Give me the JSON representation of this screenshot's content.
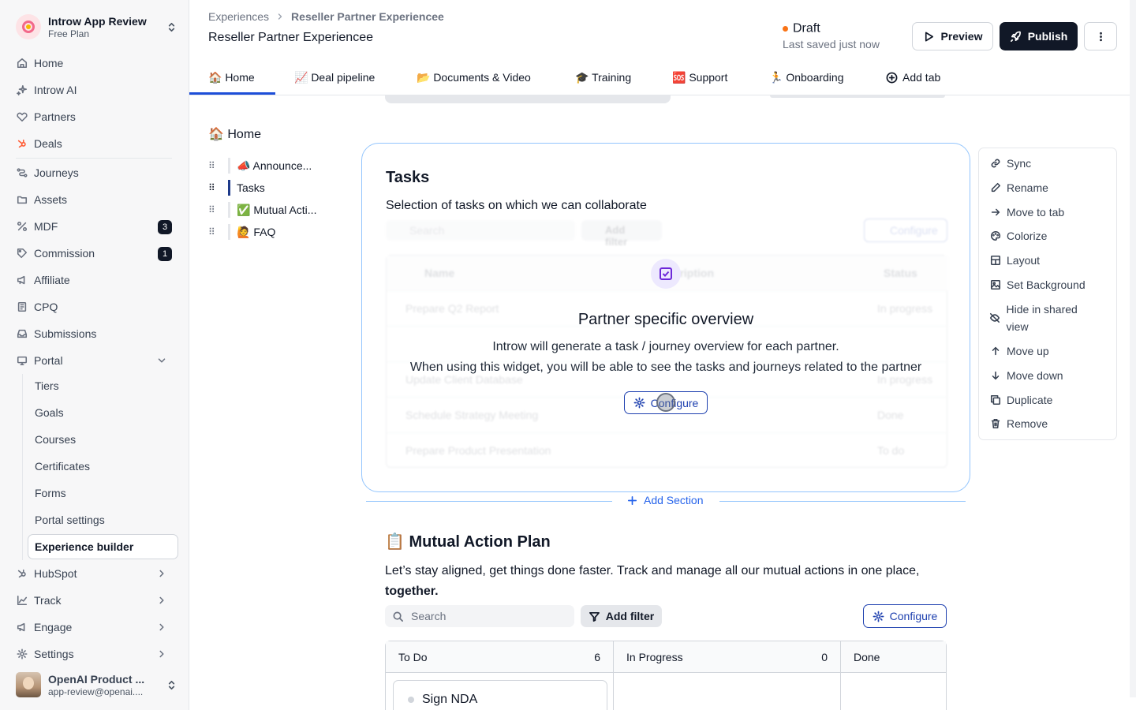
{
  "workspace": {
    "name": "Introw App Review",
    "plan": "Free Plan"
  },
  "sidebar": {
    "nav": [
      {
        "label": "Home",
        "icon": "home-icon"
      },
      {
        "label": "Introw AI",
        "icon": "sparkles-icon"
      },
      {
        "label": "Partners",
        "icon": "partners-icon"
      },
      {
        "label": "Deals",
        "icon": "hubspot-icon"
      },
      {
        "label": "Journeys",
        "icon": "journeys-icon"
      },
      {
        "label": "Assets",
        "icon": "folder-icon"
      },
      {
        "label": "MDF",
        "icon": "mdf-icon",
        "badge": "3"
      },
      {
        "label": "Commission",
        "icon": "commission-icon",
        "badge": "1"
      },
      {
        "label": "Affiliate",
        "icon": "megaphone-icon"
      },
      {
        "label": "CPQ",
        "icon": "cpq-icon"
      },
      {
        "label": "Submissions",
        "icon": "inbox-icon"
      },
      {
        "label": "Portal",
        "icon": "portal-icon"
      }
    ],
    "portal_sub": [
      "Tiers",
      "Goals",
      "Courses",
      "Certificates",
      "Forms",
      "Portal settings"
    ],
    "portal_active": "Experience builder",
    "bottom": [
      {
        "label": "HubSpot",
        "icon": "hubspot-icon"
      },
      {
        "label": "Track",
        "icon": "chart-icon"
      },
      {
        "label": "Engage",
        "icon": "megaphone-icon"
      },
      {
        "label": "Settings",
        "icon": "gear-icon"
      }
    ],
    "user": {
      "name": "OpenAI Product ...",
      "email": "app-review@openai...."
    }
  },
  "header": {
    "breadcrumb_root": "Experiences",
    "breadcrumb_current": "Reseller Partner Experiencee",
    "title": "Reseller Partner Experiencee",
    "status": "Draft",
    "status_color": "#f97316",
    "saved": "Last saved just now",
    "preview": "Preview",
    "publish": "Publish"
  },
  "tabs": [
    "🏠 Home",
    "📈 Deal pipeline",
    "📂 Documents & Video",
    "🎓 Training",
    "🆘 Support",
    "🏃 Onboarding",
    "Add tab"
  ],
  "outline": {
    "title": "🏠 Home",
    "items": [
      "📣 Announce...",
      "Tasks",
      "✅ Mutual Acti...",
      "🙋 FAQ"
    ]
  },
  "tasks_section": {
    "title": "Tasks",
    "description": "Selection of tasks on which we can collaborate",
    "ghost": {
      "search": "Search",
      "filter": "Add filter",
      "configure": "Configure",
      "headers": [
        "Name",
        "Description",
        "Status"
      ],
      "rows": [
        {
          "name": "Prepare Q2 Report",
          "status": "In progress"
        },
        {
          "name": "",
          "status": ""
        },
        {
          "name": "Update Client Database",
          "status": "In progress"
        },
        {
          "name": "Schedule Strategy Meeting",
          "status": "Done"
        },
        {
          "name": "Prepare Product Presentation",
          "status": "To do"
        }
      ]
    },
    "overlay_title": "Partner specific overview",
    "overlay_line1": "Introw will generate a task / journey overview for each partner.",
    "overlay_line2": "When using this widget, you will be able to see the tasks and journeys related to the partner",
    "overlay_button": "Configure"
  },
  "add_section": "Add Section",
  "map_section": {
    "title": "📋 Mutual Action Plan",
    "description": "Let’s stay aligned, get things done faster. Track and manage all our mutual actions in one place,",
    "description_bold": "together.",
    "search_placeholder": "Search",
    "filter": "Add filter",
    "configure": "Configure",
    "columns": [
      {
        "name": "To Do",
        "count": "6"
      },
      {
        "name": "In Progress",
        "count": "0"
      },
      {
        "name": "Done",
        "count": ""
      }
    ],
    "cards": [
      "Sign NDA"
    ]
  },
  "context_menu": [
    "Sync",
    "Rename",
    "Move to tab",
    "Colorize",
    "Layout",
    "Set Background",
    "Hide in shared view",
    "Move up",
    "Move down",
    "Duplicate",
    "Remove"
  ]
}
